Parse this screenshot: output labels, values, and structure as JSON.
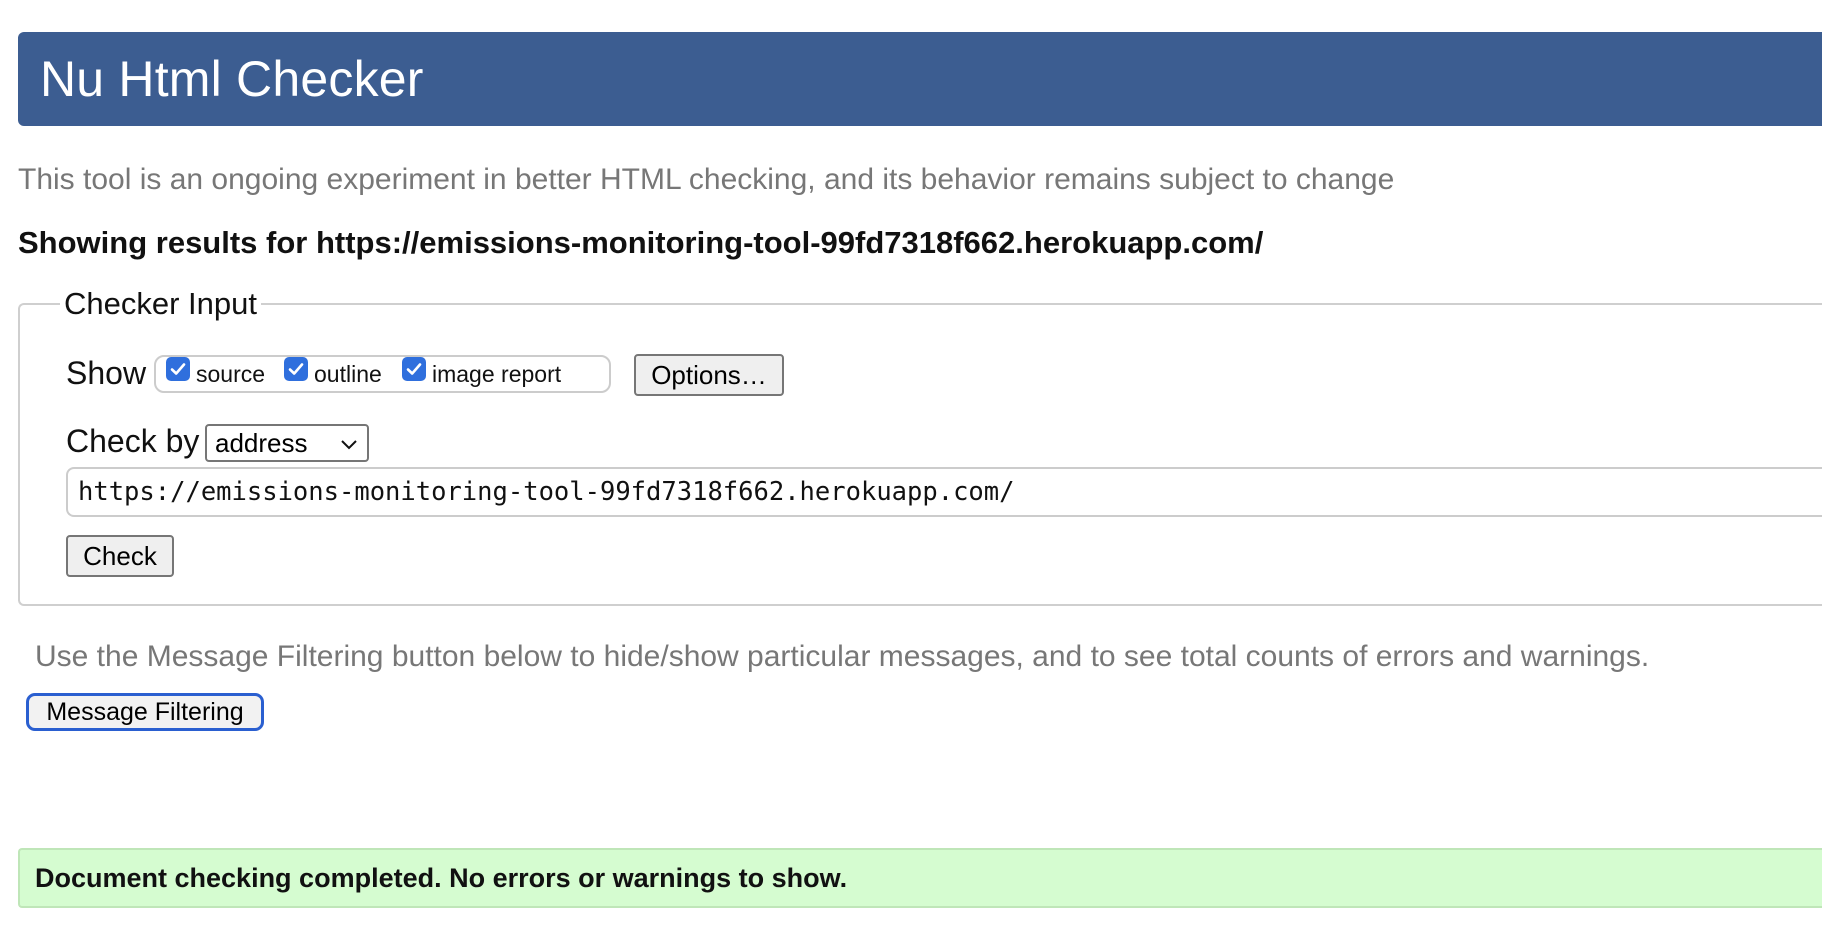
{
  "header": {
    "title": "Nu Html Checker"
  },
  "intro": {
    "subtitle": "This tool is an ongoing experiment in better HTML checking, and its behavior remains subject to change",
    "results_for": "Showing results for https://emissions-monitoring-tool-99fd7318f662.herokuapp.com/"
  },
  "checker_input": {
    "legend": "Checker Input",
    "show_label": "Show",
    "show_options": [
      {
        "label": "source",
        "checked": true
      },
      {
        "label": "outline",
        "checked": true
      },
      {
        "label": "image report",
        "checked": true
      }
    ],
    "options_button": "Options…",
    "check_by_label": "Check by",
    "check_by_selected": "address",
    "url_value": "https://emissions-monitoring-tool-99fd7318f662.herokuapp.com/",
    "check_button": "Check"
  },
  "filtering": {
    "help_text": "Use the Message Filtering button below to hide/show particular messages, and to see total counts of errors and warnings.",
    "button_label": "Message Filtering"
  },
  "result": {
    "message": "Document checking completed. No errors or warnings to show."
  },
  "colors": {
    "header_bg": "#3c5d91",
    "checkbox_accent": "#2f6fdd",
    "success_bg": "#d5fcd0",
    "focus_ring": "#2a5fd0",
    "muted_text": "#777777"
  },
  "icons": {
    "checkbox": "checkmark-icon",
    "select": "chevron-down-icon"
  }
}
